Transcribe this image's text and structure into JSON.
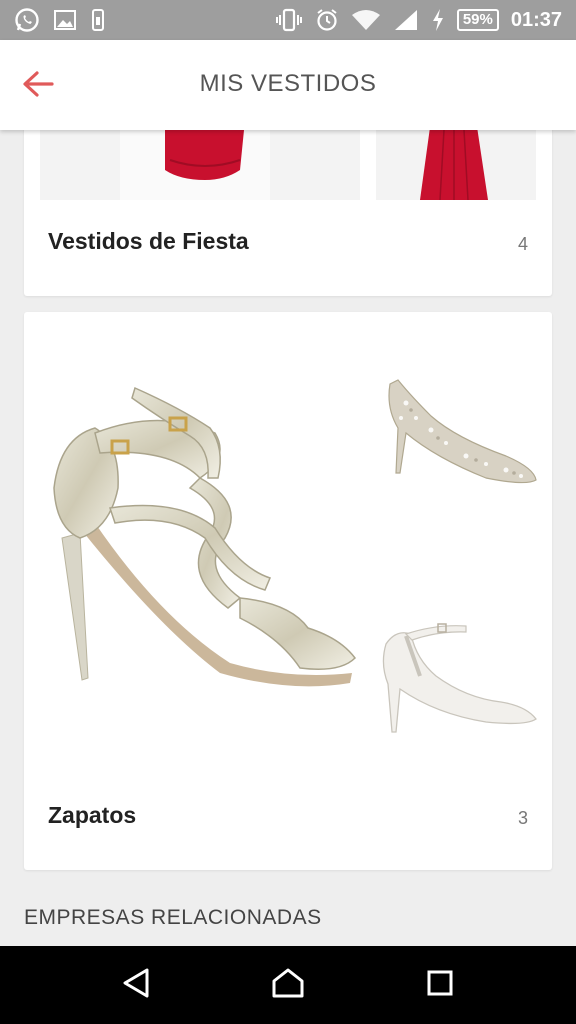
{
  "status_bar": {
    "battery": "59%",
    "time": "01:37"
  },
  "app_bar": {
    "title": "MIS VESTIDOS"
  },
  "collections": [
    {
      "label": "Vestidos de Fiesta",
      "count": "4"
    },
    {
      "label": "Zapatos",
      "count": "3"
    }
  ],
  "section": {
    "related_title": "EMPRESAS RELACIONADAS"
  },
  "colors": {
    "accent": "#e05a5a",
    "status_bar_bg": "#9e9e9e",
    "dress_red": "#c8102e"
  },
  "icons": {
    "status_left": [
      "whatsapp-icon",
      "image-icon",
      "phone-storage-icon"
    ],
    "status_right": [
      "vibrate-icon",
      "alarm-icon",
      "wifi-icon",
      "signal-icon",
      "charging-icon"
    ],
    "navigation": [
      "back-arrow-icon",
      "nav-back-icon",
      "nav-home-icon",
      "nav-recents-icon"
    ]
  }
}
